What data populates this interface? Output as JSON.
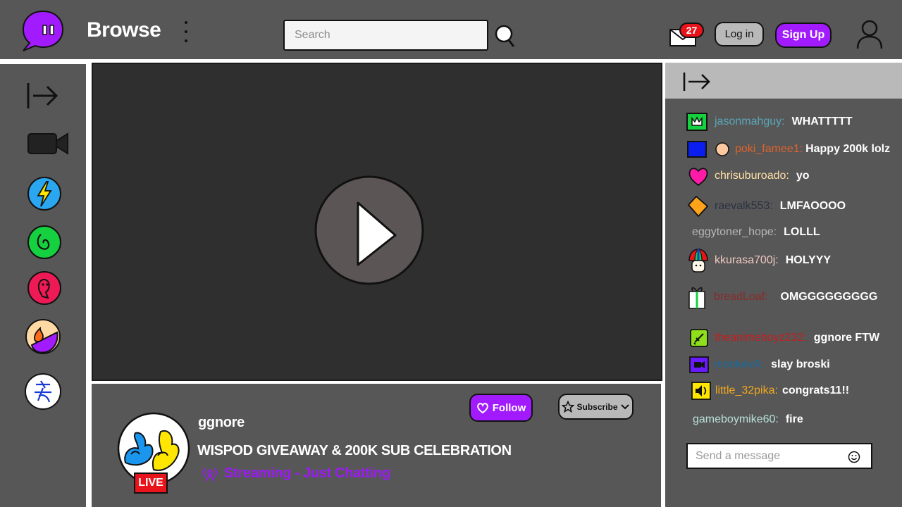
{
  "header": {
    "title": "Browse",
    "search": {
      "placeholder": "Search",
      "value": ""
    },
    "notifications_count": "27",
    "login_label": "Log in",
    "signup_label": "Sign Up"
  },
  "sidebar": {
    "items": [
      {
        "icon": "expand-arrow-icon"
      },
      {
        "icon": "video-camera-icon"
      },
      {
        "icon": "lightning-channel-icon",
        "color": "#2aa7f0"
      },
      {
        "icon": "swirl-channel-icon",
        "color": "#15d13f"
      },
      {
        "icon": "face-channel-icon",
        "color": "#ee1a55"
      },
      {
        "icon": "flame-channel-icon",
        "color": "#ffd9a3"
      },
      {
        "icon": "kanji-channel-icon",
        "color": "#ffffff"
      }
    ]
  },
  "stream": {
    "streamer": "ggnore",
    "title": "WISPOD GIVEAWAY & 200K SUB CELEBRATION",
    "category": "Streaming - Just Chatting",
    "live_label": "LIVE",
    "follow_label": "Follow",
    "subscribe_label": "Subscribe"
  },
  "chat": {
    "messages": [
      {
        "user": "jasonmahguy:",
        "text": "WHATTTTT",
        "color": "#5aa6b8",
        "icon": "crown-badge-icon"
      },
      {
        "user": "poki_famee1:",
        "text": "Happy 200k lolz",
        "color": "#e0622a",
        "icon": "blue-square-badge-icon"
      },
      {
        "user": "chrisuburoado:",
        "text": "yo",
        "color": "#ffe0a8",
        "icon": "heart-badge-icon"
      },
      {
        "user": "raevalk553:",
        "text": "LMFAOOOO",
        "color": "#2a3140",
        "icon": "diamond-badge-icon"
      },
      {
        "user": "eggytoner_hope:",
        "text": "LOLLL",
        "color": "#b8b8b8",
        "icon": ""
      },
      {
        "user": "kkurasa700j:",
        "text": "HOLYYY",
        "color": "#f0c8c0",
        "icon": "mushroom-badge-icon"
      },
      {
        "user": "breadLoaf:",
        "text": "OMGGGGGGGGG",
        "color": "#8a2a2a",
        "icon": "gift-badge-icon"
      },
      {
        "user": "theanimeboyz232:",
        "text": "ggnore FTW",
        "color": "#c02020",
        "icon": "sword-badge-icon"
      },
      {
        "user": "monkevA:",
        "text": "slay broski",
        "color": "#1a6a9a",
        "icon": "camera-badge-icon"
      },
      {
        "user": "little_32pika:",
        "text": "congrats11!!",
        "color": "#f0a81c",
        "icon": "speaker-badge-icon"
      },
      {
        "user": "gameboymike60:",
        "text": "fire",
        "color": "#b8e0d8",
        "icon": ""
      }
    ],
    "input_placeholder": "Send a message"
  }
}
